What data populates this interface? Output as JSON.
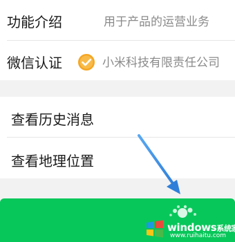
{
  "rows": [
    {
      "label": "功能介绍",
      "value": "用于产品的运营业务"
    },
    {
      "label": "微信认证",
      "value": "小米科技有限责任公司"
    }
  ],
  "actions": [
    {
      "label": "查看历史消息"
    },
    {
      "label": "查看地理位置"
    }
  ],
  "watermark": {
    "title": "windows",
    "subtitle": "系统家园",
    "url": "www.ruihaitu.com"
  },
  "colors": {
    "accent_green": "#08c75a",
    "badge_orange": "#f5a623",
    "arrow_blue": "#3a8fe6",
    "background": "#f2f2f2"
  },
  "icons": [
    "verified-badge-icon",
    "annotation-arrow-icon",
    "windows-logo-icon"
  ]
}
